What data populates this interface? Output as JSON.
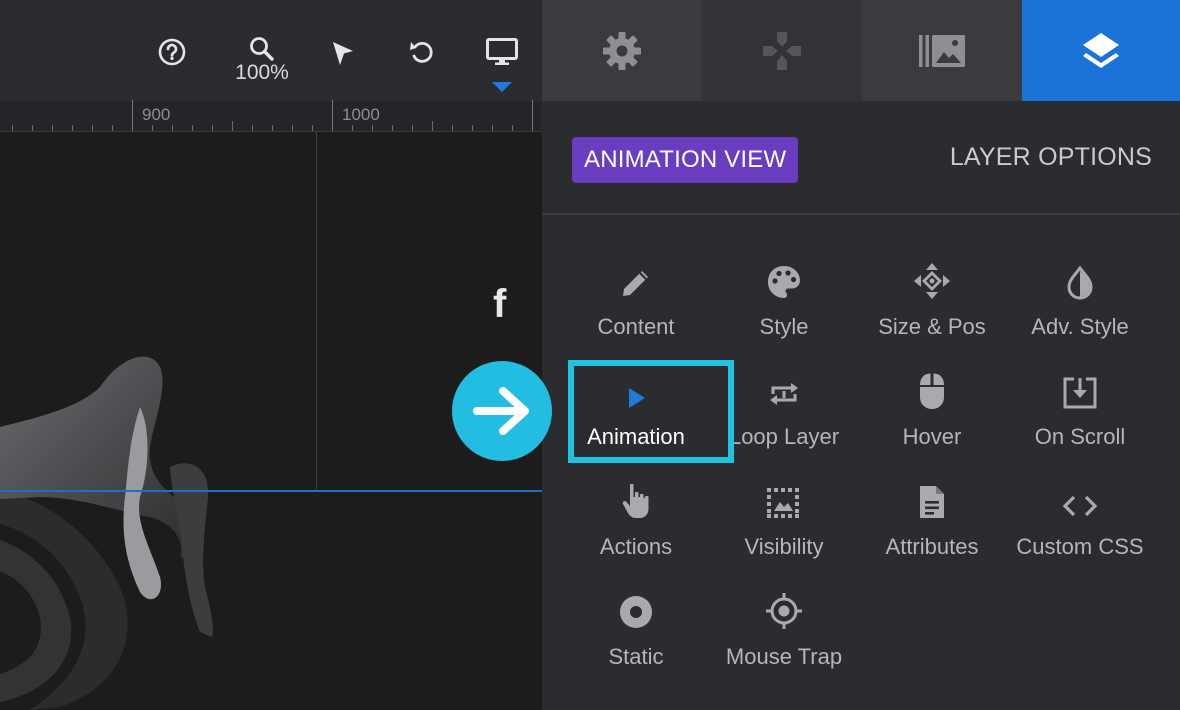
{
  "toolbar": {
    "zoom_label": "100%",
    "icons": [
      "help-icon",
      "zoom-icon",
      "cursor-icon",
      "undo-icon",
      "desktop-icon"
    ]
  },
  "ruler": {
    "labels": [
      "900",
      "1000"
    ]
  },
  "stage": {
    "social_glyph": "f"
  },
  "panel": {
    "tabs": [
      {
        "icon": "gear-icon",
        "active": false
      },
      {
        "icon": "gamepad-icon",
        "active": false
      },
      {
        "icon": "media-library-icon",
        "active": false
      },
      {
        "icon": "layers-icon",
        "active": true
      }
    ],
    "animation_view_label": "ANIMATION VIEW",
    "layer_options_label": "LAYER OPTIONS",
    "options": [
      {
        "label": "Content",
        "icon": "pencil-icon"
      },
      {
        "label": "Style",
        "icon": "palette-icon"
      },
      {
        "label": "Size & Pos",
        "icon": "move-icon"
      },
      {
        "label": "Adv. Style",
        "icon": "contrast-drop-icon"
      },
      {
        "label": "Animation",
        "icon": "play-icon",
        "selected": true
      },
      {
        "label": "Loop Layer",
        "icon": "loop-icon"
      },
      {
        "label": "Hover",
        "icon": "mouse-icon"
      },
      {
        "label": "On Scroll",
        "icon": "scroll-download-icon"
      },
      {
        "label": "Actions",
        "icon": "touch-icon"
      },
      {
        "label": "Visibility",
        "icon": "visibility-icon"
      },
      {
        "label": "Attributes",
        "icon": "document-icon"
      },
      {
        "label": "Custom CSS",
        "icon": "code-icon"
      },
      {
        "label": "Static",
        "icon": "static-circle-icon"
      },
      {
        "label": "Mouse Trap",
        "icon": "crosshair-icon"
      }
    ]
  },
  "colors": {
    "accent_blue": "#1b73d8",
    "purple_button": "#6a3cc0",
    "highlight_cyan": "#22c1e0",
    "panel_bg": "#2b2c30"
  }
}
